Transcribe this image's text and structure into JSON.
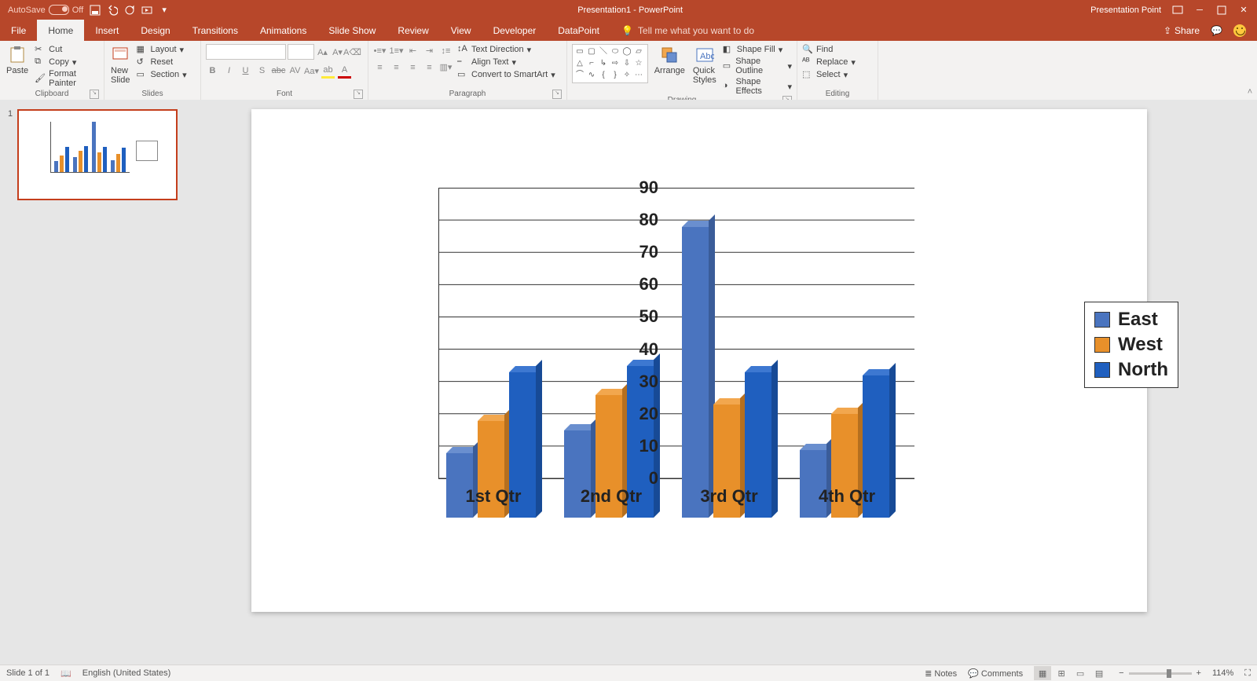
{
  "titlebar": {
    "autosave_label": "AutoSave",
    "autosave_state": "Off",
    "doc_title": "Presentation1 - PowerPoint",
    "presentation_point": "Presentation Point"
  },
  "tabs": [
    "File",
    "Home",
    "Insert",
    "Design",
    "Transitions",
    "Animations",
    "Slide Show",
    "Review",
    "View",
    "Developer",
    "DataPoint"
  ],
  "active_tab": "Home",
  "tellme": "Tell me what you want to do",
  "share": "Share",
  "ribbon": {
    "clipboard": {
      "paste": "Paste",
      "cut": "Cut",
      "copy": "Copy",
      "format_painter": "Format Painter",
      "label": "Clipboard"
    },
    "slides": {
      "new_slide": "New\nSlide",
      "layout": "Layout",
      "reset": "Reset",
      "section": "Section",
      "label": "Slides"
    },
    "font": {
      "label": "Font"
    },
    "paragraph": {
      "text_direction": "Text Direction",
      "align_text": "Align Text",
      "convert": "Convert to SmartArt",
      "label": "Paragraph"
    },
    "drawing": {
      "arrange": "Arrange",
      "quick_styles": "Quick\nStyles",
      "shape_fill": "Shape Fill",
      "shape_outline": "Shape Outline",
      "shape_effects": "Shape Effects",
      "label": "Drawing"
    },
    "editing": {
      "find": "Find",
      "replace": "Replace",
      "select": "Select",
      "label": "Editing"
    }
  },
  "thumb": {
    "index": "1"
  },
  "chart_data": {
    "type": "bar",
    "categories": [
      "1st Qtr",
      "2nd Qtr",
      "3rd Qtr",
      "4th Qtr"
    ],
    "series": [
      {
        "name": "East",
        "values": [
          20,
          27,
          90,
          21
        ]
      },
      {
        "name": "West",
        "values": [
          30,
          38,
          35,
          32
        ]
      },
      {
        "name": "North",
        "values": [
          45,
          47,
          45,
          44
        ]
      }
    ],
    "ylim": [
      0,
      90
    ],
    "yticks": [
      0,
      10,
      20,
      30,
      40,
      50,
      60,
      70,
      80,
      90
    ],
    "legend": [
      "East",
      "West",
      "North"
    ],
    "colors": {
      "East": "#4A74BF",
      "West": "#E8902A",
      "North": "#1F5FBF"
    }
  },
  "status": {
    "slide_of": "Slide 1 of 1",
    "language": "English (United States)",
    "notes": "Notes",
    "comments": "Comments",
    "zoom": "114%"
  }
}
